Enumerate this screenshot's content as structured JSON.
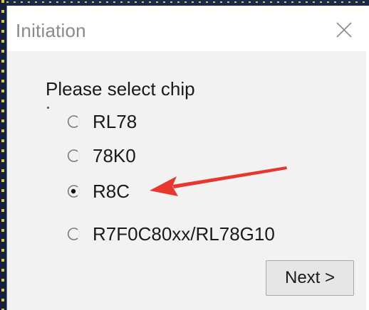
{
  "window": {
    "title": "Initiation"
  },
  "dialog": {
    "prompt": "Please select chip",
    "options": [
      {
        "label": "RL78",
        "selected": false
      },
      {
        "label": "78K0",
        "selected": false
      },
      {
        "label": "R8C",
        "selected": true
      },
      {
        "label": "R7F0C80xx/RL78G10",
        "selected": false
      }
    ],
    "next_label": "Next >"
  },
  "annotation": {
    "arrow_color": "#e8382e",
    "points_to": "R8C"
  },
  "icons": {
    "close": "close-icon"
  },
  "colors": {
    "title_text": "#8a8a8a",
    "dialog_bg": "#f2f2f2",
    "background_strip": "#15213a"
  }
}
